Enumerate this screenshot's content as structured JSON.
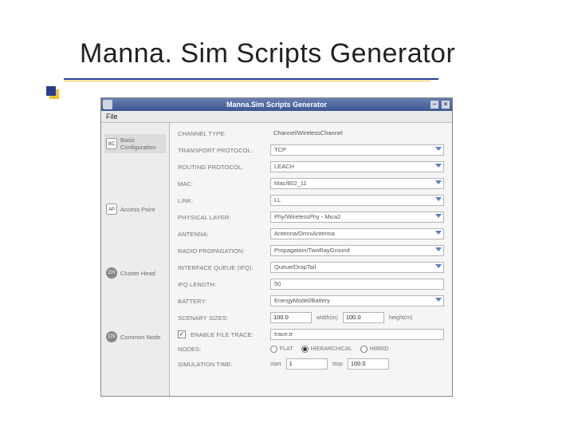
{
  "slide": {
    "title": "Manna. Sim Scripts Generator"
  },
  "window": {
    "title": "Manna.Sim Scripts Generator",
    "menu": {
      "file": "File"
    }
  },
  "sidebar": {
    "items": [
      {
        "icon": "BC",
        "label": "Basic Configuration"
      },
      {
        "icon": "AP",
        "label": "Access Point"
      },
      {
        "icon": "CH",
        "label": "Cluster Head"
      },
      {
        "icon": "CN",
        "label": "Common Node"
      }
    ]
  },
  "form": {
    "channelType": {
      "label": "CHANNEL TYPE:",
      "value": "Channel/WirelessChannel"
    },
    "transport": {
      "label": "TRANSPORT PROTOCOL:",
      "value": "TCP"
    },
    "routing": {
      "label": "ROUTING PROTOCOL:",
      "value": "LEACH"
    },
    "mac": {
      "label": "MAC:",
      "value": "Mac/802_11"
    },
    "link": {
      "label": "LINK:",
      "value": "LL"
    },
    "phyLayer": {
      "label": "PHYSICAL LAYER:",
      "value": "Phy/WirelessPhy - Mica2"
    },
    "antenna": {
      "label": "ANTENNA:",
      "value": "Antenna/OmniAntenna"
    },
    "propagation": {
      "label": "RADIO PROPAGATION:",
      "value": "Propagation/TwoRayGround"
    },
    "ifqType": {
      "label": "INTERFACE QUEUE (IFQ):",
      "value": "Queue/DropTail"
    },
    "ifqLength": {
      "label": "IFQ LENGTH:",
      "value": "50"
    },
    "battery": {
      "label": "BATTERY:",
      "value": "EnergyModel/Battery"
    },
    "scenarioSizes": {
      "label": "SCENARY SIZES:",
      "width": "100.0",
      "widthLabel": "width(m)",
      "height": "100.0",
      "heightLabel": "height(m)"
    },
    "outputFile": {
      "checkLabel": "ENABLE FILE TRACE:",
      "value": "trace.tr"
    },
    "nodes": {
      "label": "NODES:",
      "options": [
        "FLAT",
        "HIERARCHICAL",
        "HIBRID"
      ],
      "selected": 1
    },
    "simTime": {
      "label": "SIMULATION TIME:",
      "start": "1",
      "startLabel": "start",
      "stop": "100.0",
      "stopLabel": "stop"
    }
  }
}
